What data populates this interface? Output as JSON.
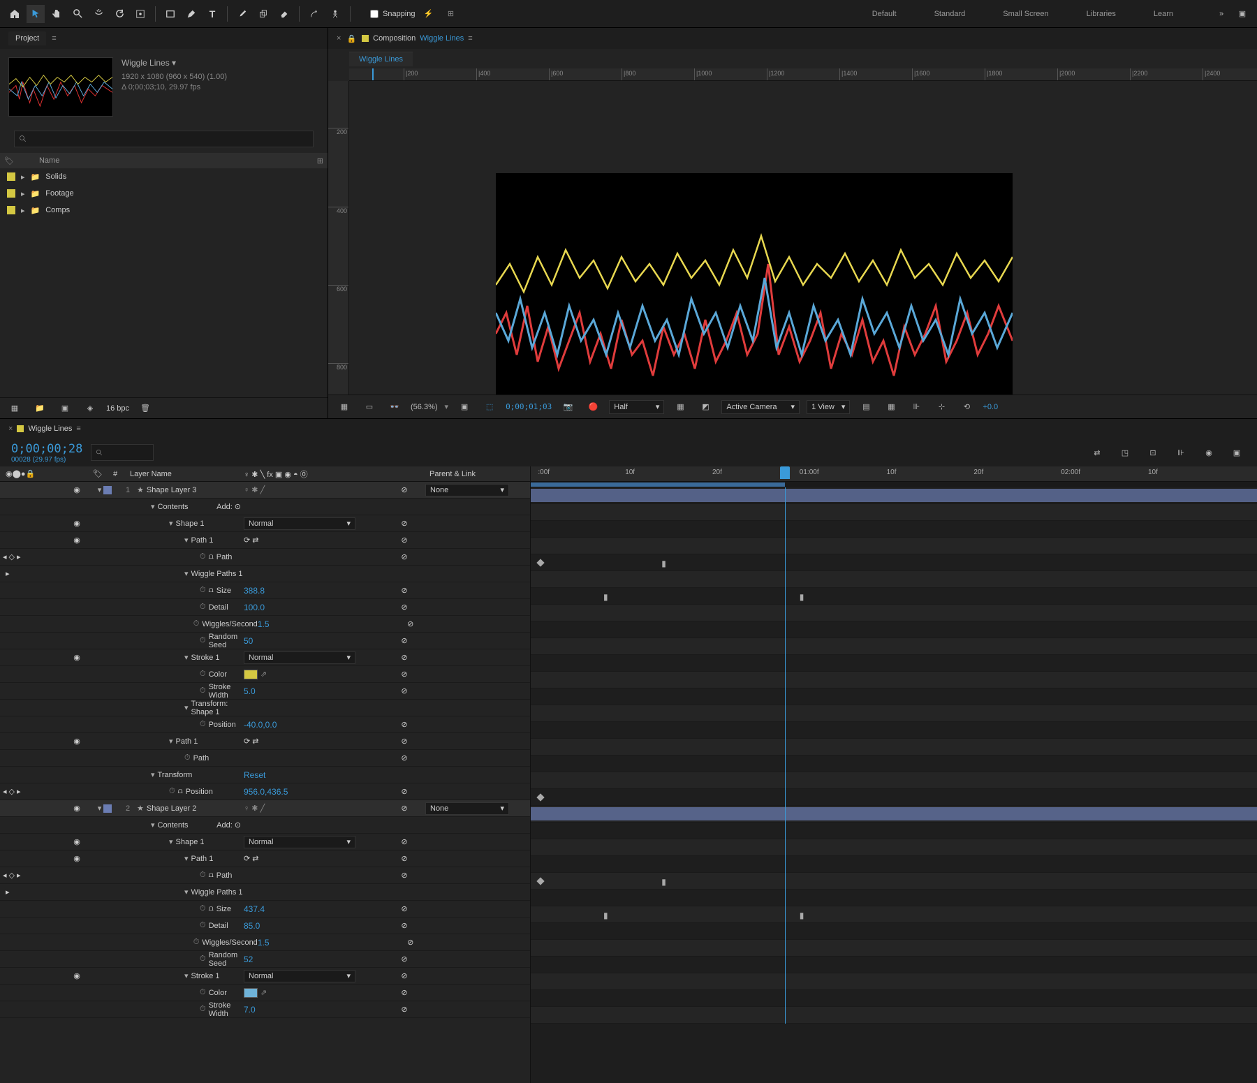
{
  "toolbar": {
    "snapping_label": "Snapping"
  },
  "workspaces": [
    "Default",
    "Standard",
    "Small Screen",
    "Libraries",
    "Learn"
  ],
  "project": {
    "tab": "Project",
    "comp_title": "Wiggle Lines ▾",
    "comp_res": "1920 x 1080  (960 x 540) (1.00)",
    "comp_dur": "Δ 0;00;03;10, 29.97 fps",
    "name_header": "Name",
    "folders": [
      "Solids",
      "Footage",
      "Comps"
    ],
    "bpc": "16 bpc"
  },
  "viewer": {
    "panel_label": "Composition",
    "comp_link": "Wiggle Lines",
    "sub_tab": "Wiggle Lines",
    "zoom": "(56.3%)",
    "timecode": "0;00;01;03",
    "res": "Half",
    "camera": "Active Camera",
    "views": "1 View",
    "exposure": "+0.0",
    "ruler_h": [
      "200",
      "400",
      "600",
      "800",
      "1000",
      "1200",
      "1400",
      "1600",
      "1800",
      "2000",
      "2200",
      "2400"
    ],
    "ruler_v": [
      "200",
      "400",
      "600",
      "800"
    ]
  },
  "timeline": {
    "tab": "Wiggle Lines",
    "timecode": "0;00;00;28",
    "tc_sub": "00028 (29.97 fps)",
    "ruler": [
      ":00f",
      "10f",
      "20f",
      "01:00f",
      "10f",
      "20f",
      "02:00f",
      "10f"
    ],
    "col_layer_name": "Layer Name",
    "col_num": "#",
    "col_switches_icons": "♀ ✱ ╲ fx ▣ ◉ ◓ ⓪",
    "col_parent": "Parent & Link",
    "add_label": "Add:"
  },
  "layers": [
    {
      "num": "1",
      "name": "Shape Layer 3",
      "parent": "None",
      "contents_label": "Contents",
      "shape_label": "Shape 1",
      "shape_mode": "Normal",
      "path1_label": "Path 1",
      "path_prop": "Path",
      "wiggle_label": "Wiggle Paths 1",
      "size_label": "Size",
      "size_val": "388.8",
      "detail_label": "Detail",
      "detail_val": "100.0",
      "wps_label": "Wiggles/Second",
      "wps_val": "1.5",
      "seed_label": "Random Seed",
      "seed_val": "50",
      "stroke_label": "Stroke 1",
      "stroke_mode": "Normal",
      "color_label": "Color",
      "color_val": "#d4c842",
      "sw_label": "Stroke Width",
      "sw_val": "5.0",
      "tshape_label": "Transform: Shape 1",
      "tshape_pos_label": "Position",
      "tshape_pos_val": "-40.0,0.0",
      "path2_label": "Path 1",
      "path2_prop": "Path",
      "transform_label": "Transform",
      "transform_reset": "Reset",
      "t_pos_label": "Position",
      "t_pos_val": "956.0,436.5"
    },
    {
      "num": "2",
      "name": "Shape Layer 2",
      "parent": "None",
      "contents_label": "Contents",
      "shape_label": "Shape 1",
      "shape_mode": "Normal",
      "path1_label": "Path 1",
      "path_prop": "Path",
      "wiggle_label": "Wiggle Paths 1",
      "size_label": "Size",
      "size_val": "437.4",
      "detail_label": "Detail",
      "detail_val": "85.0",
      "wps_label": "Wiggles/Second",
      "wps_val": "1.5",
      "seed_label": "Random Seed",
      "seed_val": "52",
      "stroke_label": "Stroke 1",
      "stroke_mode": "Normal",
      "color_label": "Color",
      "color_val": "#6fb3d9",
      "sw_label": "Stroke Width",
      "sw_val": "7.0"
    }
  ]
}
